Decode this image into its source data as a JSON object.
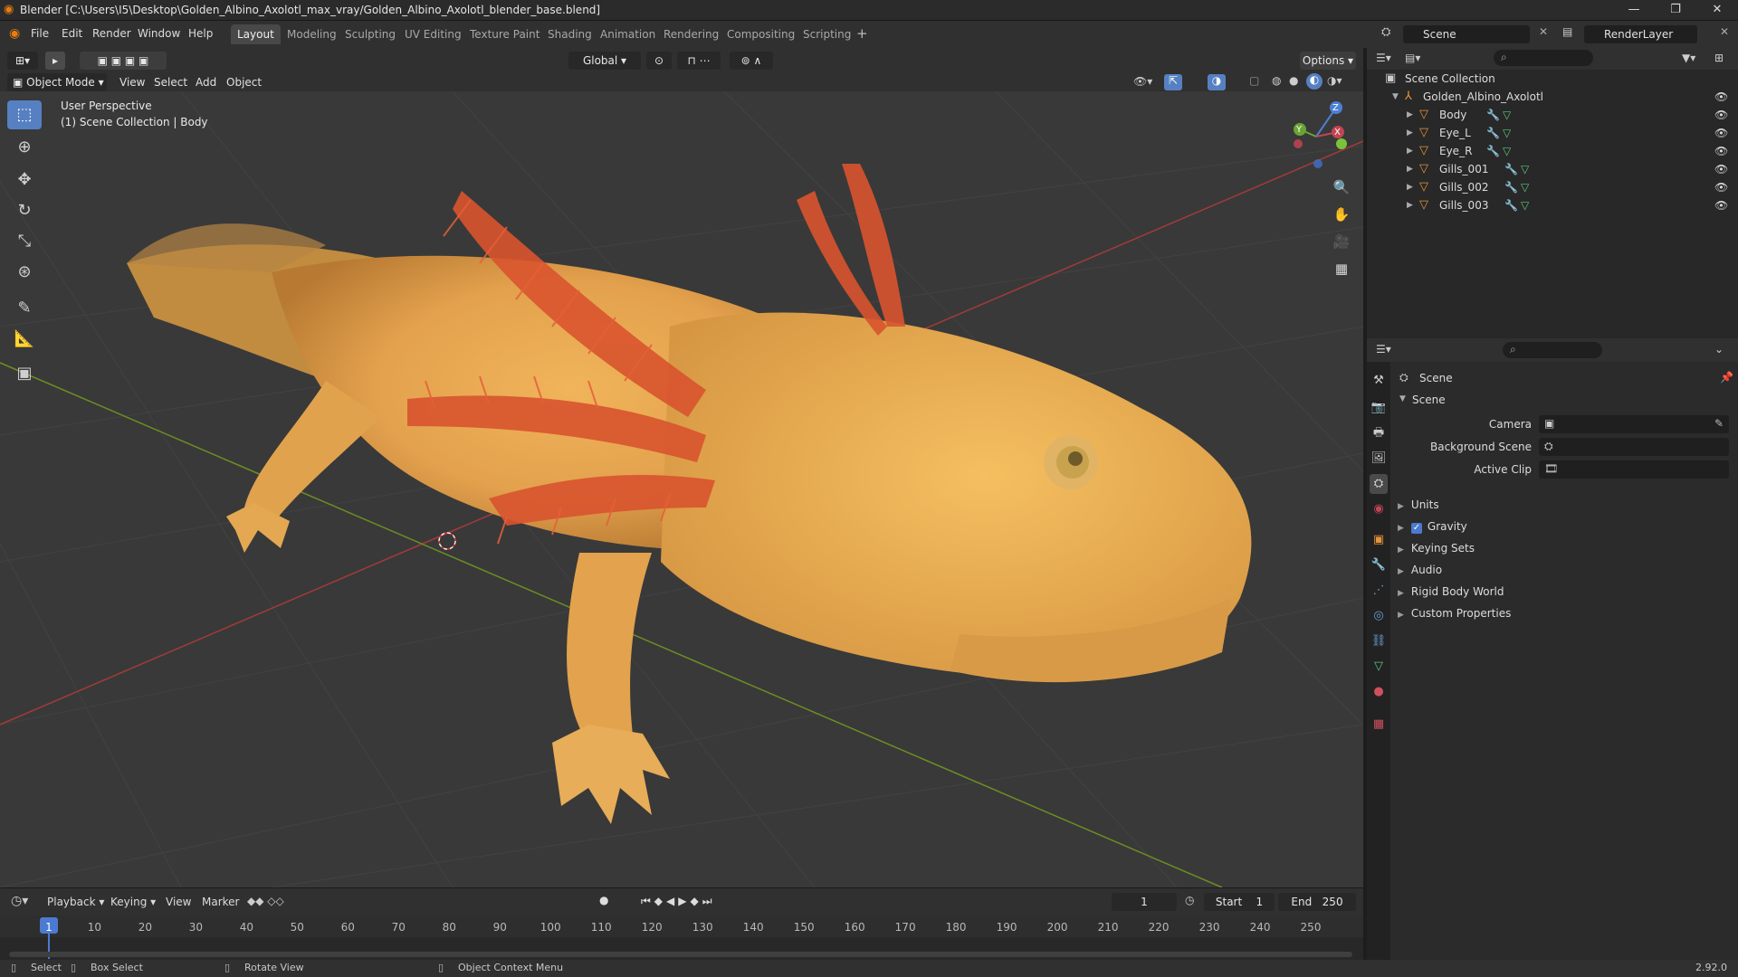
{
  "window": {
    "title": "Blender [C:\\Users\\I5\\Desktop\\Golden_Albino_Axolotl_max_vray/Golden_Albino_Axolotl_blender_base.blend]",
    "minimize": "—",
    "maximize": "❐",
    "close": "✕"
  },
  "menu": {
    "items": [
      "File",
      "Edit",
      "Render",
      "Window",
      "Help"
    ]
  },
  "workspaces": [
    "Layout",
    "Modeling",
    "Sculpting",
    "UV Editing",
    "Texture Paint",
    "Shading",
    "Animation",
    "Rendering",
    "Compositing",
    "Scripting"
  ],
  "workspace_add": "+",
  "scene_selector": {
    "value": "Scene"
  },
  "layer_selector": {
    "value": "RenderLayer"
  },
  "viewport_header": {
    "mode": "Object Mode",
    "menus": [
      "View",
      "Select",
      "Add",
      "Object"
    ],
    "transform_orientation": "Global",
    "options": "Options"
  },
  "viewport": {
    "perspective": "User Perspective",
    "context": "(1) Scene Collection | Body",
    "gizmo": {
      "x": "X",
      "y": "Y",
      "z": "Z"
    }
  },
  "outliner": {
    "root": "Scene Collection",
    "collection": "Golden_Albino_Axolotl",
    "objects": [
      "Body",
      "Eye_L",
      "Eye_R",
      "Gills_001",
      "Gills_002",
      "Gills_003"
    ]
  },
  "properties": {
    "header": "Scene",
    "panel": "Scene",
    "fields": {
      "camera": "Camera",
      "background_scene": "Background Scene",
      "active_clip": "Active Clip"
    },
    "subpanels": [
      "Units",
      "Gravity",
      "Keying Sets",
      "Audio",
      "Rigid Body World",
      "Custom Properties"
    ],
    "gravity_checked": true
  },
  "timeline": {
    "menus": [
      "Playback",
      "Keying",
      "View",
      "Marker"
    ],
    "current_frame": "1",
    "start_label": "Start",
    "start_value": "1",
    "end_label": "End",
    "end_value": "250",
    "ticks": [
      "1",
      "10",
      "20",
      "30",
      "40",
      "50",
      "60",
      "70",
      "80",
      "90",
      "100",
      "110",
      "120",
      "130",
      "140",
      "150",
      "160",
      "170",
      "180",
      "190",
      "200",
      "210",
      "220",
      "230",
      "240",
      "250"
    ]
  },
  "statusbar": {
    "select": "Select",
    "box_select": "Box Select",
    "rotate_view": "Rotate View",
    "context_menu": "Object Context Menu",
    "version": "2.92.0"
  }
}
